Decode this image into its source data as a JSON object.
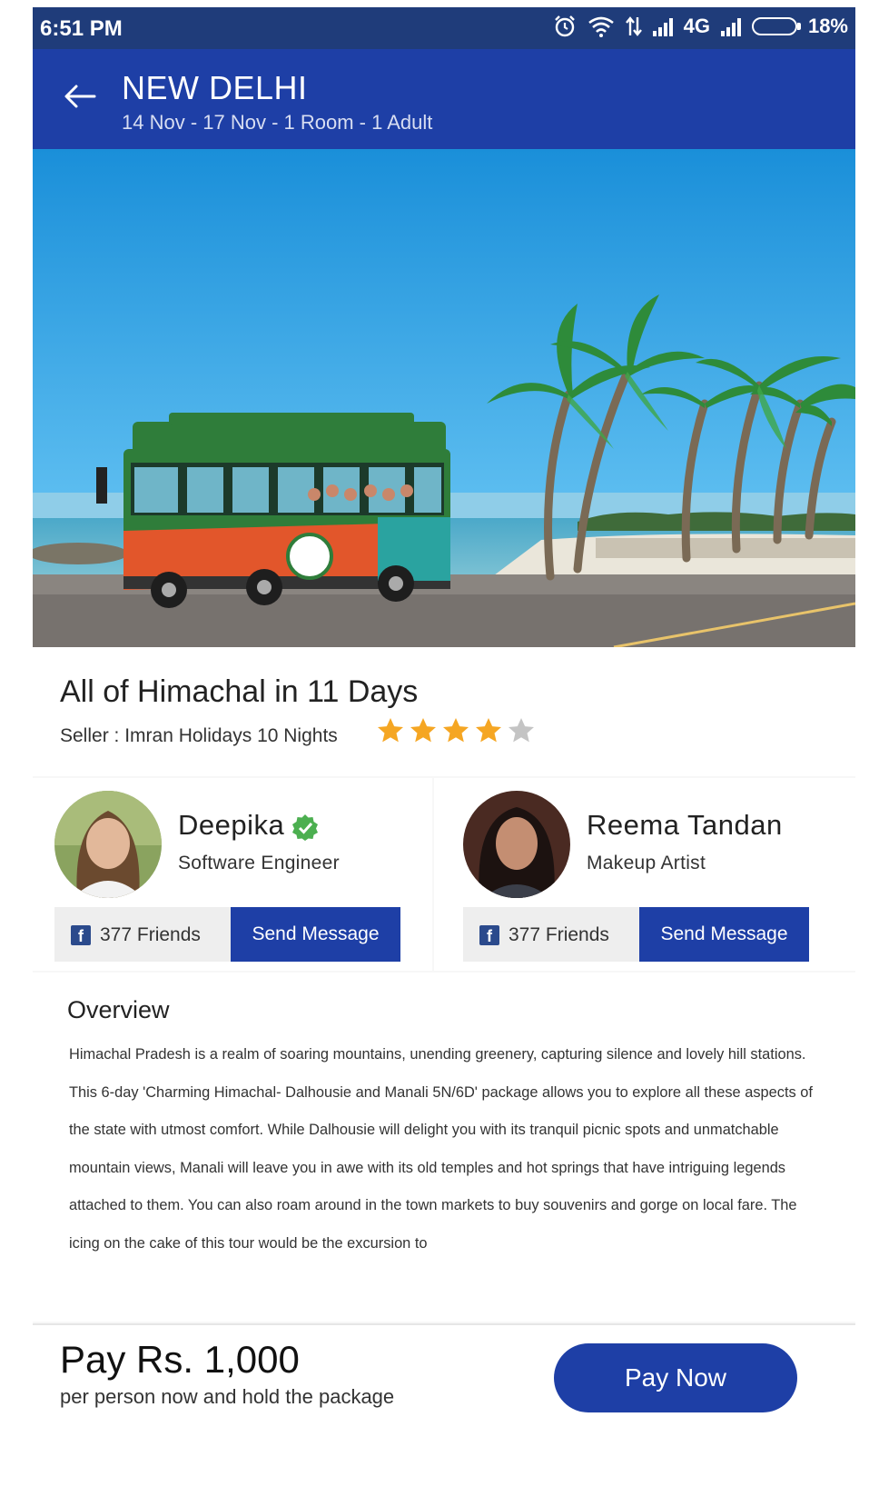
{
  "status_bar": {
    "time": "6:51 PM",
    "network": "4G",
    "battery": "18%"
  },
  "header": {
    "title": "NEW DELHI",
    "subtitle": "14 Nov  - 17 Nov  - 1 Room  -  1 Adult"
  },
  "package": {
    "name": "All of Himachal in 11 Days",
    "seller": "Seller : Imran Holidays 10 Nights",
    "rating": 4,
    "rating_max": 5
  },
  "users": [
    {
      "name": "Deepika",
      "role": "Software Engineer",
      "verified": true,
      "friends": "377 Friends",
      "button": "Send Message"
    },
    {
      "name": "Reema Tandan",
      "role": "Makeup Artist",
      "verified": false,
      "friends": "377 Friends",
      "button": "Send Message"
    }
  ],
  "overview": {
    "title": "Overview",
    "text": "Himachal Pradesh is a realm of soaring mountains, unending greenery, capturing silence and lovely hill stations. This 6-day 'Charming Himachal- Dalhousie and Manali 5N/6D' package allows you to explore all these aspects of the state with utmost comfort. While Dalhousie will delight you with its tranquil picnic spots and unmatchable mountain views, Manali will leave you in awe with its old temples and hot springs that have intriguing legends attached to them. You can also roam around in the town markets to buy souvenirs and gorge on local fare. The icing on the cake of this tour would be the excursion to"
  },
  "payment": {
    "amount": "Pay Rs. 1,000",
    "note": "per person now and hold the package",
    "button": "Pay Now"
  },
  "colors": {
    "primary": "#1e3fa6",
    "status_bar": "#1f3c7a",
    "star": "#f5a623",
    "verified": "#4caf50",
    "facebook": "#2b4a8c"
  }
}
